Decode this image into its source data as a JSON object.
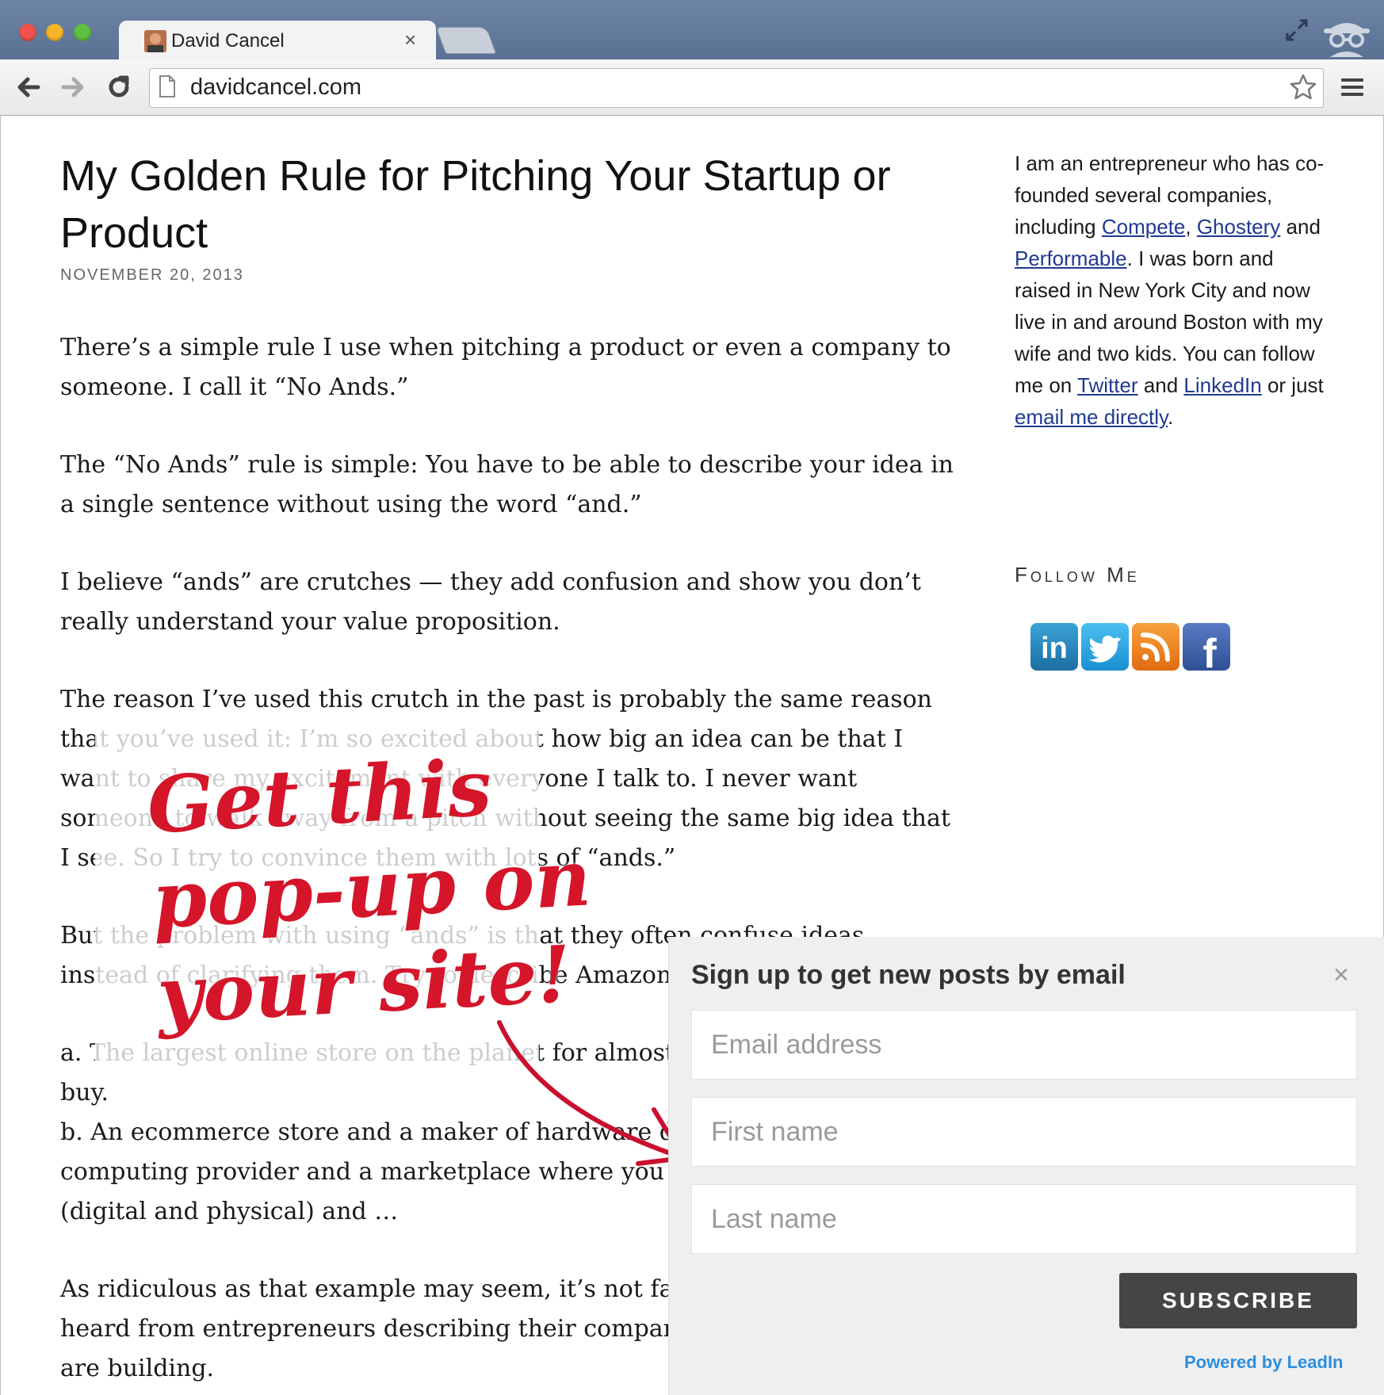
{
  "browser": {
    "tab_title": "David Cancel",
    "tab_close": "×",
    "url": "davidcancel.com"
  },
  "post": {
    "title": "My Golden Rule for Pitching Your Startup or Product",
    "date": "NOVEMBER 20, 2013",
    "paragraphs": [
      "There’s a simple rule I use when pitching a product or even a company to someone. I call it “No Ands.”",
      "The “No Ands” rule is simple: You have to be able to describe your idea in a single sentence without using the word “and.”",
      "I believe “ands” are crutches — they add confusion and show you don’t really understand your value proposition.",
      "The reason I’ve used this crutch in the past is probably the same reason that you’ve used it: I’m so excited about how big an idea can be that I want to share my excitement with everyone I talk to. I never want someone to walk away from a pitch without seeing the same big idea that I see. So I try to convince them with lots of “ands.”",
      "But the problem with using “ands” is that they often confuse ideas instead of clarifying them. Try to describe Amazon:",
      "a. The largest online store on the planet for almost anything you could buy.\nb. An ecommerce store and a maker of hardware devices and a cloud computing provider and a marketplace where you can buy anything (digital and physical) and …",
      "As ridiculous as that example may seem, it’s not far off from what I’ve heard from entrepreneurs describing their company or the product they are building."
    ]
  },
  "sidebar": {
    "bio_part1": "I am an entrepreneur who has co-founded several companies, including ",
    "link_compete": "Compete",
    "sep1": ", ",
    "link_ghostery": "Ghostery",
    "and1": " and ",
    "link_performable": "Performable",
    "bio_part2": ". I was born and raised in New York City and now live in and around Boston with my wife and two kids. You can follow me on ",
    "link_twitter": "Twitter",
    "and2": " and ",
    "link_linkedin": "LinkedIn",
    "bio_part3": " or just ",
    "link_email": "email me directly",
    "bio_end": ".",
    "follow_heading": "Follow Me",
    "social_icons": [
      "linkedin-icon",
      "twitter-icon",
      "rss-icon",
      "facebook-icon"
    ],
    "social_labels": {
      "linkedin": "in",
      "twitter": "t",
      "facebook": "f"
    }
  },
  "promo": {
    "line1": "Get this",
    "line2": "pop-up on",
    "line3": "your site!"
  },
  "popup": {
    "title": "Sign up to get new posts by email",
    "close": "×",
    "email_placeholder": "Email address",
    "first_name_placeholder": "First name",
    "last_name_placeholder": "Last name",
    "subscribe_label": "SUBSCRIBE",
    "powered_by": "Powered by LeadIn"
  },
  "colors": {
    "link": "#1f3a8f",
    "promo_red": "#d4152a",
    "leadin_blue": "#2b8fe0",
    "chrome_blue": "#5a7193"
  }
}
